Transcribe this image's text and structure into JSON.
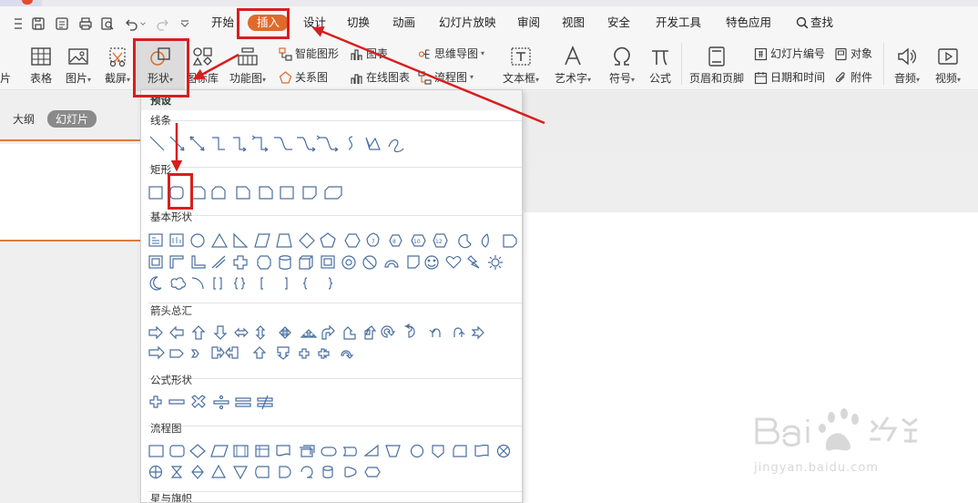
{
  "menu": {
    "tabs": [
      "开始",
      "插入",
      "设计",
      "切换",
      "动画",
      "幻灯片放映",
      "审阅",
      "视图",
      "安全",
      "开发工具",
      "特色应用"
    ],
    "active_tab": "插入",
    "search_label": "查找"
  },
  "ribbon": {
    "edge_label": "片",
    "table": "表格",
    "picture": "图片",
    "screenshot": "截屏",
    "shapes": "形状",
    "icon_lib": "图标库",
    "func_chart": "功能图",
    "smart_art": "智能图形",
    "chart": "图表",
    "mind_map": "思维导图",
    "relation": "关系图",
    "online_chart": "在线图表",
    "flowchart": "流程图",
    "textbox": "文本框",
    "wordart": "艺术字",
    "symbol": "符号",
    "formula": "公式",
    "header_footer": "页眉和页脚",
    "slide_number": "幻灯片编号",
    "object": "对象",
    "date_time": "日期和时间",
    "attachment": "附件",
    "audio": "音频",
    "video": "视频",
    "caret": "▾"
  },
  "left_panel": {
    "tab_outline": "大纲",
    "tab_slides": "幻灯片"
  },
  "dropdown": {
    "preset": "预设",
    "lines": "线条",
    "rect": "矩形",
    "basic": "基本形状",
    "arrows": "箭头总汇",
    "equation": "公式形状",
    "flow": "流程图",
    "stars": "星与旗帜"
  },
  "watermark": {
    "url": "jingyan.baidu.com"
  }
}
